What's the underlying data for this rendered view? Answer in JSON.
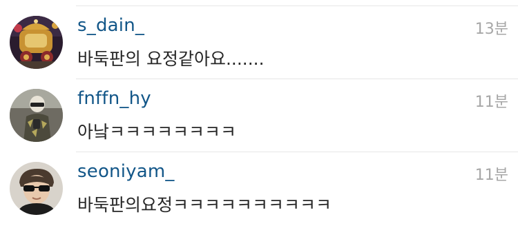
{
  "comments": [
    {
      "username": "s_dain_",
      "time": "13분",
      "text": "바둑판의 요정같아요.......",
      "avatar_icon": "carousel-carriage-photo"
    },
    {
      "username": "fnffn_hy",
      "time": "11분",
      "text": "아낰ㅋㅋㅋㅋㅋㅋㅋㅋ",
      "avatar_icon": "person-in-patterned-jacket-photo"
    },
    {
      "username": "seoniyam_",
      "time": "11분",
      "text": "바둑판의요정ㅋㅋㅋㅋㅋㅋㅋㅋㅋㅋ",
      "avatar_icon": "person-with-sunglasses-photo"
    }
  ],
  "colors": {
    "username": "#125688",
    "timestamp": "#a7a7a7",
    "text": "#262626",
    "divider": "#e6e6e6"
  }
}
